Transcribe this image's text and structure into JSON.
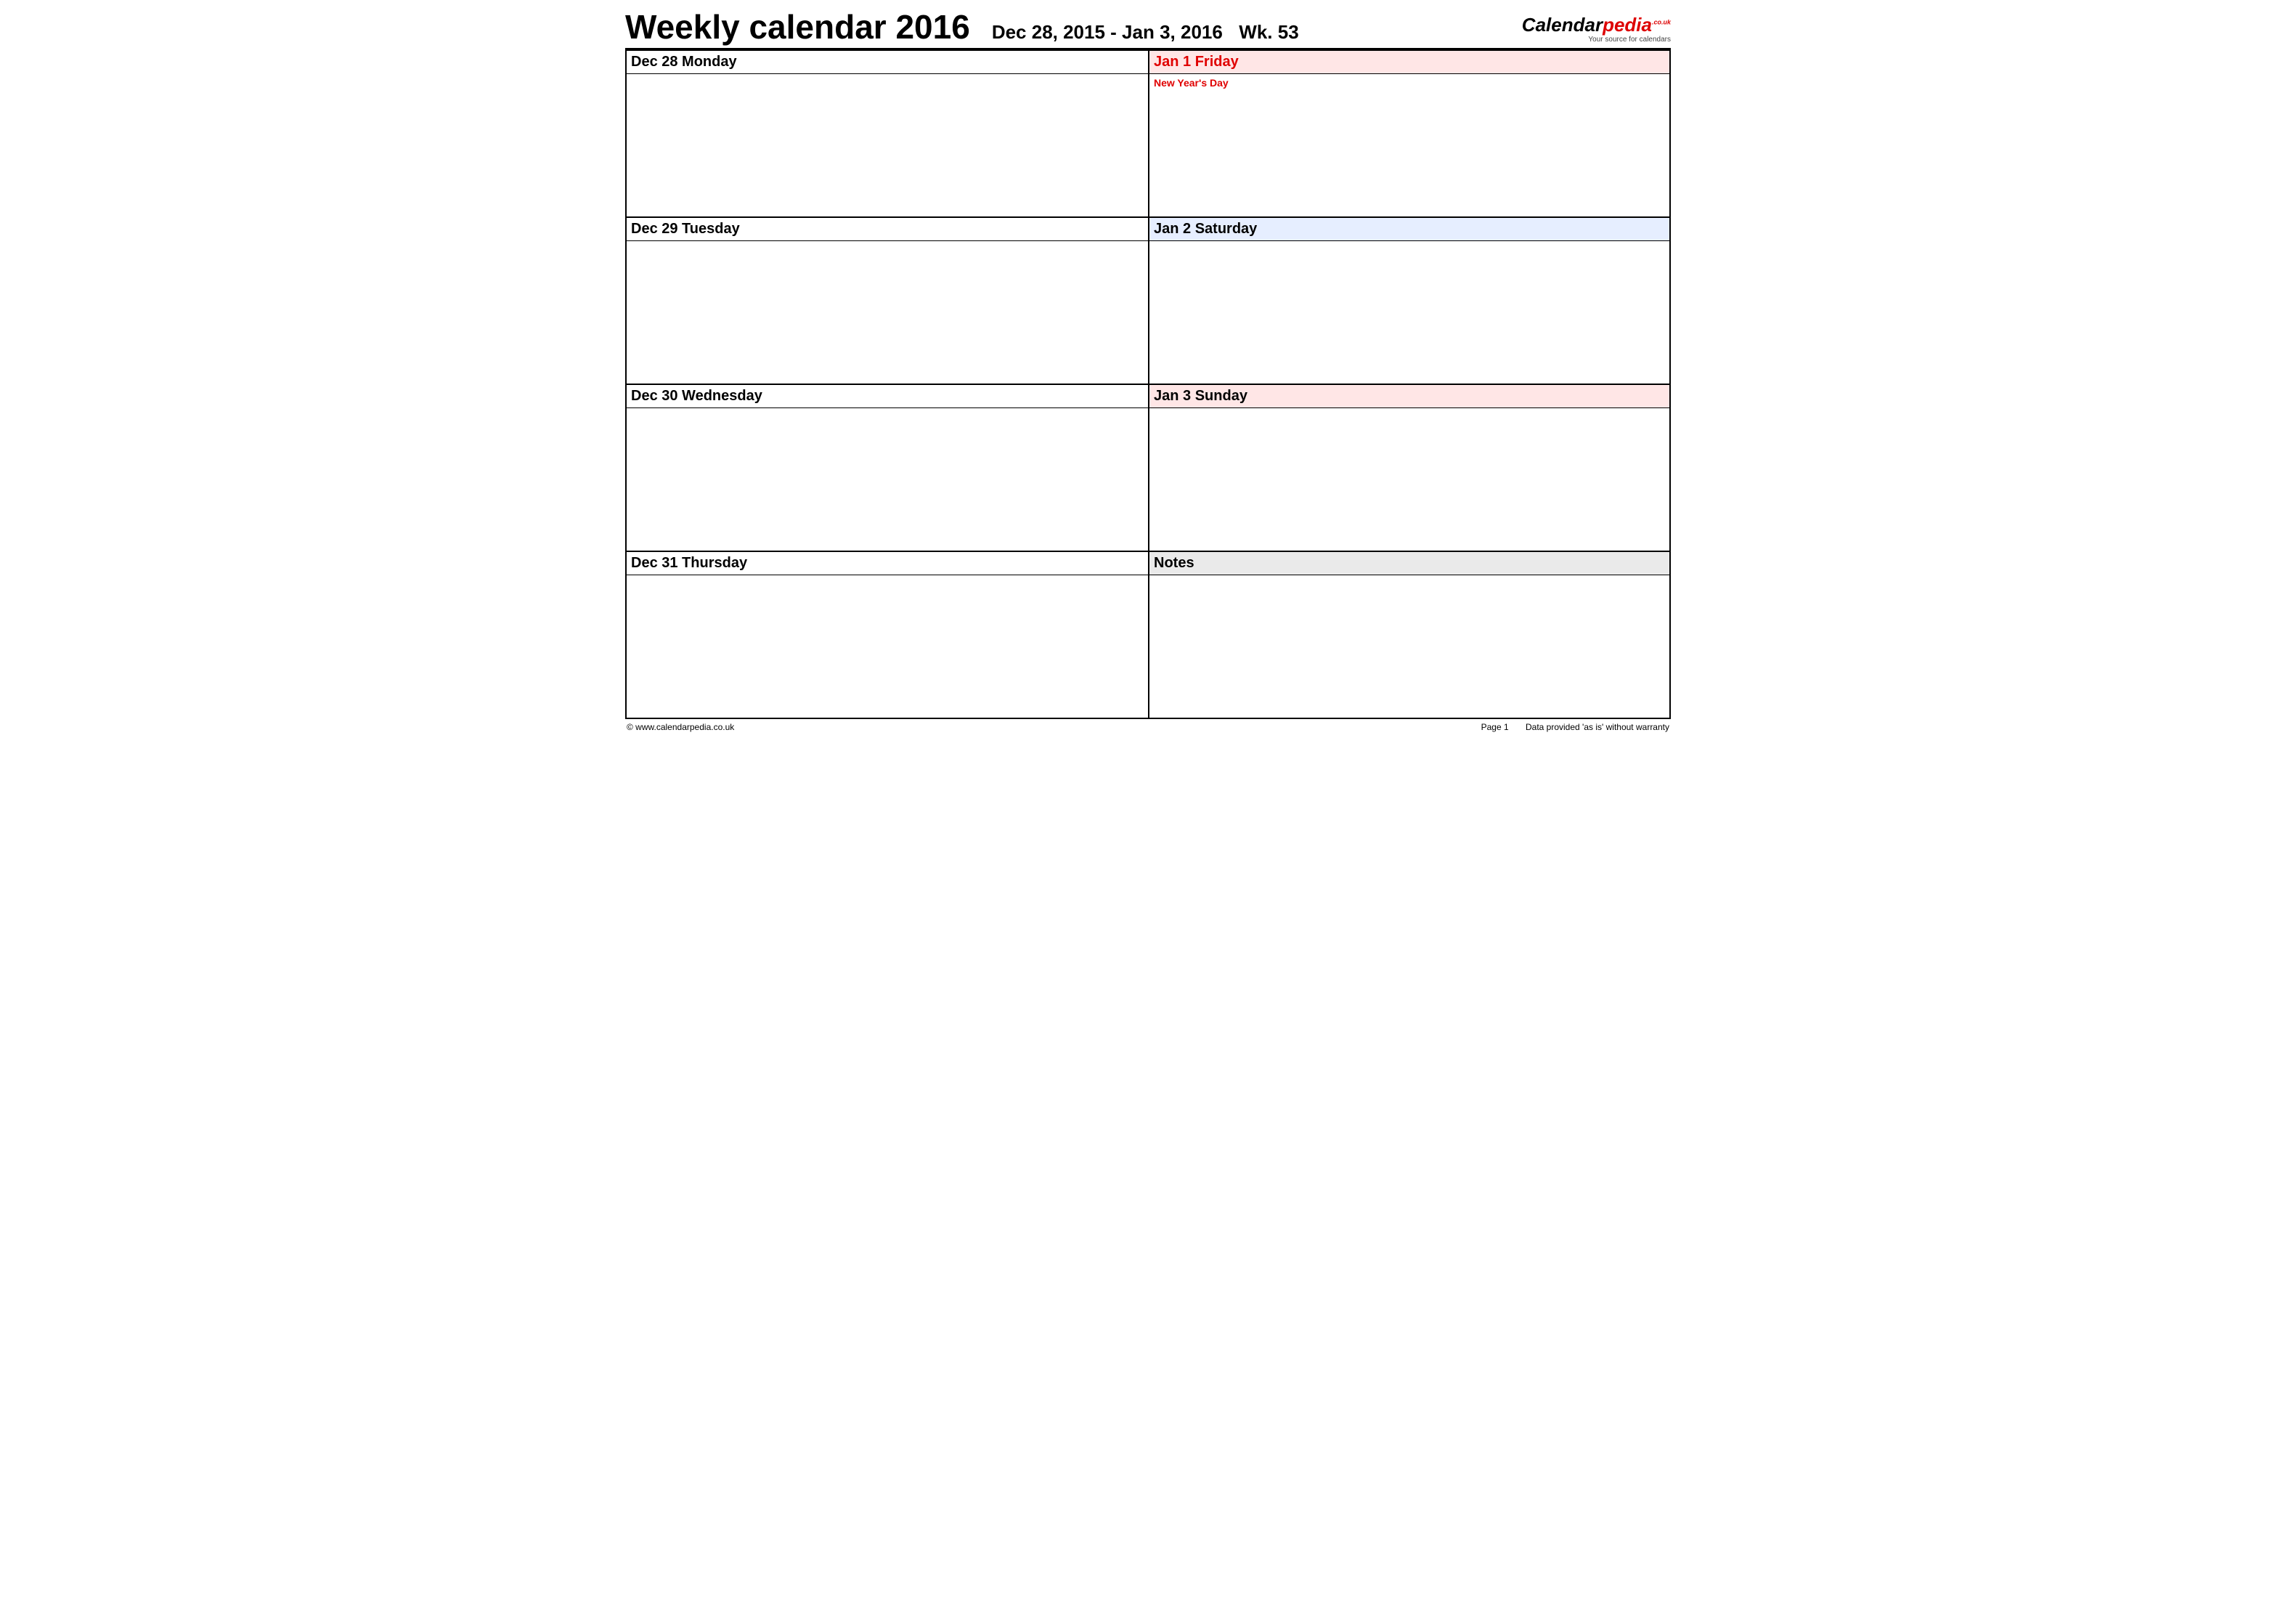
{
  "header": {
    "title": "Weekly calendar 2016",
    "date_range": "Dec 28, 2015 - Jan 3, 2016",
    "week_label": "Wk. 53"
  },
  "logo": {
    "part1": "Calendar",
    "part2": "pedia",
    "suffix": ".co.uk",
    "tagline": "Your source for calendars"
  },
  "cells": {
    "left": [
      {
        "head": "Dec 28  Monday",
        "body": ""
      },
      {
        "head": "Dec 29  Tuesday",
        "body": ""
      },
      {
        "head": "Dec 30  Wednesday",
        "body": ""
      },
      {
        "head": "Dec 31  Thursday",
        "body": ""
      }
    ],
    "right": [
      {
        "head": "Jan 1  Friday",
        "body": "New Year's Day"
      },
      {
        "head": "Jan 2  Saturday",
        "body": ""
      },
      {
        "head": "Jan 3  Sunday",
        "body": ""
      },
      {
        "head": "Notes",
        "body": ""
      }
    ]
  },
  "footer": {
    "copyright": "© www.calendarpedia.co.uk",
    "page": "Page 1",
    "disclaimer": "Data provided 'as is' without warranty"
  }
}
